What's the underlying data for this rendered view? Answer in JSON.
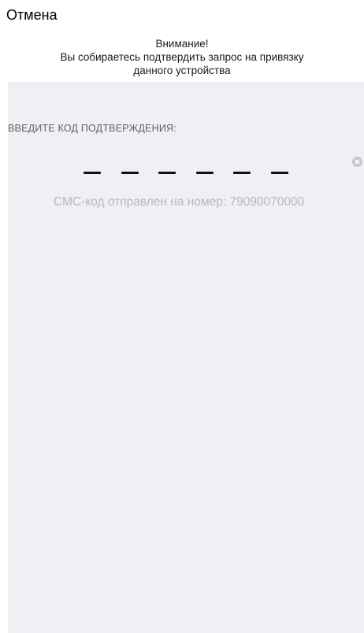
{
  "header": {
    "cancel_label": "Отмена"
  },
  "notice": {
    "title": "Внимание!",
    "line1": "Вы собираетесь подтвердить запрос на привязку",
    "line2": "данного устройства"
  },
  "code_entry": {
    "caption": "ВВЕДИТЕ КОД ПОДТВЕРЖДЕНИЯ:",
    "digit_count": 6,
    "value": "",
    "clear_icon": "clear-circle-icon"
  },
  "sms": {
    "message": "СМС-код отправлен на номер: 79090070000"
  },
  "colors": {
    "panel_background": "#efeff4",
    "hint_text": "#b7b7bd",
    "slot_dash": "#111111"
  }
}
